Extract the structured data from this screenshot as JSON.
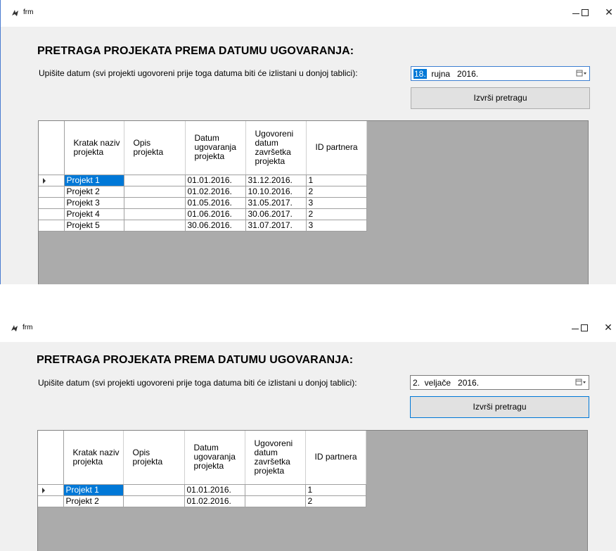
{
  "windows": [
    {
      "title": "frm",
      "heading": "PRETRAGA PROJEKATA PREMA DATUMU UGOVARANJA:",
      "prompt": "Upišite datum (svi projekti ugovoreni prije toga datuma biti će izlistani u donjoj tablici):",
      "date": {
        "day": "18.",
        "rest": "  rujna   2016."
      },
      "search_button": "Izvrši pretragu",
      "columns": [
        "Kratak naziv projekta",
        "Opis projekta",
        "Datum ugovaranja projekta",
        "Ugovoreni datum završetka projekta",
        "ID partnera"
      ],
      "rows": [
        [
          "Projekt 1",
          "",
          "01.01.2016.",
          "31.12.2016.",
          "1"
        ],
        [
          "Projekt 2",
          "",
          "01.02.2016.",
          "10.10.2016.",
          "2"
        ],
        [
          "Projekt 3",
          "",
          "01.05.2016.",
          "31.05.2017.",
          "3"
        ],
        [
          "Projekt 4",
          "",
          "01.06.2016.",
          "30.06.2017.",
          "2"
        ],
        [
          "Projekt 5",
          "",
          "30.06.2016.",
          "31.07.2017.",
          "3"
        ]
      ]
    },
    {
      "title": "frm",
      "heading": "PRETRAGA PROJEKATA PREMA DATUMU UGOVARANJA:",
      "prompt": "Upišite datum (svi projekti ugovoreni prije toga datuma biti će izlistani u donjoj tablici):",
      "date": {
        "day": "",
        "rest": "2.  veljače   2016."
      },
      "search_button": "Izvrši pretragu",
      "columns": [
        "Kratak naziv projekta",
        "Opis projekta",
        "Datum ugovaranja projekta",
        "Ugovoreni datum završetka projekta",
        "ID partnera"
      ],
      "rows": [
        [
          "Projekt 1",
          "",
          "01.01.2016.",
          "",
          "1"
        ],
        [
          "Projekt 2",
          "",
          "01.02.2016.",
          "",
          "2"
        ]
      ]
    }
  ],
  "colors": {
    "selection": "#0078d7",
    "grid_background": "#ababab",
    "window_background": "#f0f0f0"
  },
  "icons": {
    "app": "app-icon",
    "calendar": "calendar-dropdown-icon",
    "row_pointer": "row-pointer-icon"
  }
}
